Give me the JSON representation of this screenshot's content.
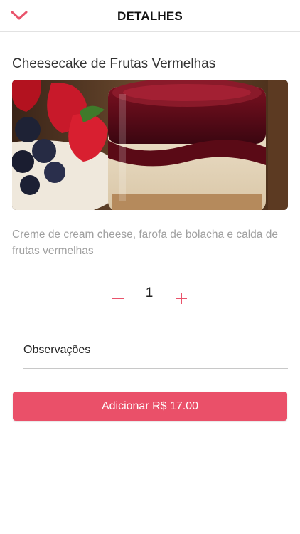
{
  "header": {
    "title": "DETALHES",
    "back_icon": "chevron-down-icon",
    "accent_color": "#e9536b"
  },
  "product": {
    "name": "Cheesecake de Frutas Vermelhas",
    "description": "Creme de cream cheese, farofa de bolacha e calda de frutas vermelhas"
  },
  "quantity": {
    "value": "1",
    "minus_icon": "minus-icon",
    "plus_icon": "plus-icon"
  },
  "notes": {
    "placeholder": "Observações",
    "value": ""
  },
  "add_button": {
    "label": "Adicionar R$ 17.00",
    "color": "#ea5069"
  }
}
